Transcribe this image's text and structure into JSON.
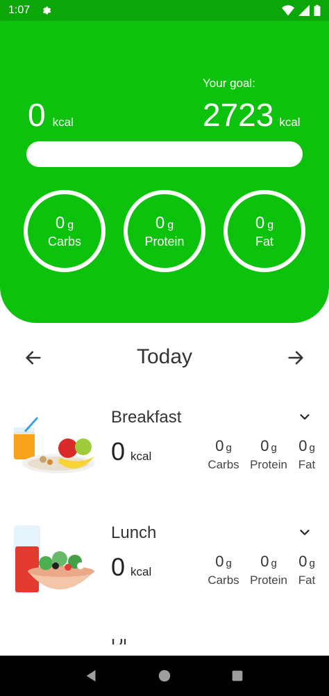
{
  "status": {
    "time": "1:07"
  },
  "summary": {
    "goal_label": "Your goal:",
    "consumed": "0",
    "consumed_unit": "kcal",
    "goal": "2723",
    "goal_unit": "kcal",
    "progress_fraction": 0,
    "macros": [
      {
        "value": "0",
        "unit": "g",
        "label": "Carbs"
      },
      {
        "value": "0",
        "unit": "g",
        "label": "Protein"
      },
      {
        "value": "0",
        "unit": "g",
        "label": "Fat"
      }
    ]
  },
  "day_nav": {
    "title": "Today"
  },
  "meals": [
    {
      "name": "Breakfast",
      "kcal": "0",
      "kcal_unit": "kcal",
      "macros": [
        {
          "value": "0",
          "unit": "g",
          "label": "Carbs"
        },
        {
          "value": "0",
          "unit": "g",
          "label": "Protein"
        },
        {
          "value": "0",
          "unit": "g",
          "label": "Fat"
        }
      ]
    },
    {
      "name": "Lunch",
      "kcal": "0",
      "kcal_unit": "kcal",
      "macros": [
        {
          "value": "0",
          "unit": "g",
          "label": "Carbs"
        },
        {
          "value": "0",
          "unit": "g",
          "label": "Protein"
        },
        {
          "value": "0",
          "unit": "g",
          "label": "Fat"
        }
      ]
    }
  ],
  "next_meal_peek": "Di",
  "colors": {
    "brand_green": "#0cc20c",
    "status_green": "#0aa60a"
  }
}
